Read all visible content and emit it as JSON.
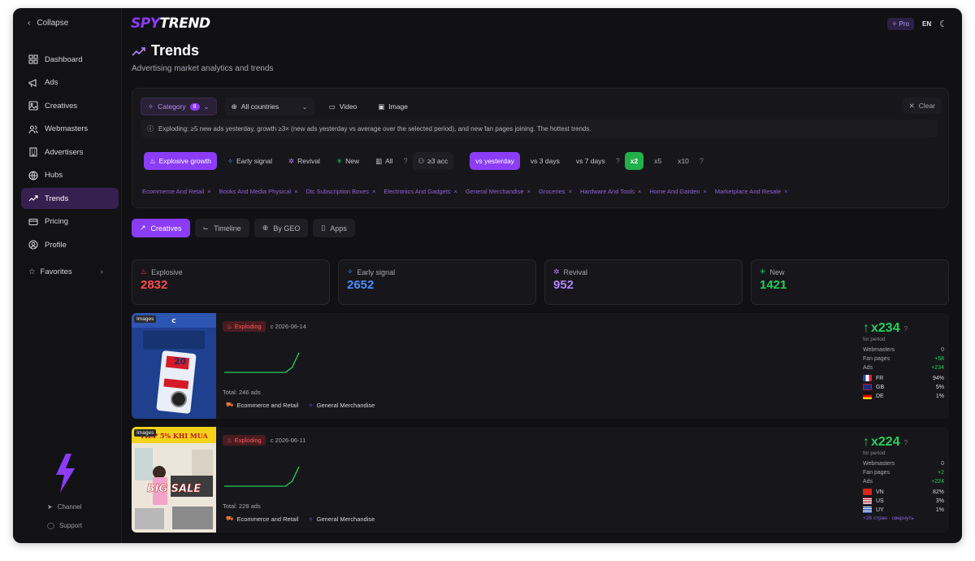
{
  "app": {
    "logo_part1": "SPY",
    "logo_part2": "TREND",
    "pro": "Pro",
    "lang": "EN"
  },
  "sidebar": {
    "collapse": "Collapse",
    "items": [
      {
        "label": "Dashboard",
        "icon": "dashboard-icon"
      },
      {
        "label": "Ads",
        "icon": "megaphone-icon"
      },
      {
        "label": "Creatives",
        "icon": "image-icon"
      },
      {
        "label": "Webmasters",
        "icon": "users-icon"
      },
      {
        "label": "Advertisers",
        "icon": "building-icon"
      },
      {
        "label": "Hubs",
        "icon": "globe-icon"
      },
      {
        "label": "Trends",
        "icon": "trend-icon",
        "active": true
      },
      {
        "label": "Pricing",
        "icon": "card-icon"
      },
      {
        "label": "Profile",
        "icon": "profile-icon"
      }
    ],
    "favorites": "Favorites",
    "channel": "Channel",
    "support": "Support"
  },
  "page": {
    "title": "Trends",
    "subtitle": "Advertising market analytics and trends"
  },
  "filters": {
    "category": "Category",
    "category_count": "8",
    "countries": "All countries",
    "video": "Video",
    "image": "Image",
    "clear": "Clear",
    "info": "Exploding: ≥5 new ads yesterday, growth ≥3× (new ads yesterday vs average over the selected period), and new fan pages joining. The hottest trends.",
    "signals": [
      "Explosive growth",
      "Early signal",
      "Revival",
      "New",
      "All"
    ],
    "acc": "≥3 acc",
    "periods": [
      "vs yesterday",
      "vs 3 days",
      "vs 7 days"
    ],
    "multipliers": [
      "x2",
      "x5",
      "x10"
    ],
    "tags": [
      "Ecommerce And Retail",
      "Books And Media Physical",
      "Dtc Subscription Boxes",
      "Electronics And Gadgets",
      "General Merchandise",
      "Groceries",
      "Hardware And Tools",
      "Home And Garden",
      "Marketplace And Resale"
    ]
  },
  "tabs": [
    "Creatives",
    "Timeline",
    "By GEO",
    "Apps"
  ],
  "stats": [
    {
      "label": "Explosive",
      "value": "2832",
      "color": "#ff4a4a"
    },
    {
      "label": "Early signal",
      "value": "2652",
      "color": "#4a8cff"
    },
    {
      "label": "Revival",
      "value": "952",
      "color": "#b084f7"
    },
    {
      "label": "New",
      "value": "1421",
      "color": "#21d05a"
    }
  ],
  "cards": [
    {
      "thumb_tag": "Images",
      "status": "Exploding",
      "since": "c 2026-06-14",
      "total": "Total: 246 ads",
      "cats": [
        "Ecommerce and Retail",
        "General Merchandise"
      ],
      "mult": "x234",
      "for_period": "for period",
      "webmasters_label": "Webmasters",
      "webmasters": "0",
      "fanpages_label": "Fan pages",
      "fanpages": "+58",
      "ads_label": "Ads",
      "ads": "+234",
      "geo": [
        {
          "code": "FR",
          "pct": "94%"
        },
        {
          "code": "GB",
          "pct": "5%"
        },
        {
          "code": "DE",
          "pct": "1%"
        }
      ],
      "more": "",
      "spark": [
        1,
        1,
        1,
        1,
        1,
        1,
        1,
        1,
        1,
        1,
        3,
        9
      ]
    },
    {
      "thumb_tag": "Images",
      "status": "Exploding",
      "since": "c 2026-06-11",
      "total": "Total: 228 ads",
      "cats": [
        "Ecommerce and Retail",
        "General Merchandise"
      ],
      "mult": "x224",
      "for_period": "for period",
      "webmasters_label": "Webmasters",
      "webmasters": "0",
      "fanpages_label": "Fan pages",
      "fanpages": "+2",
      "ads_label": "Ads",
      "ads": "+224",
      "geo": [
        {
          "code": "VN",
          "pct": "82%"
        },
        {
          "code": "US",
          "pct": "3%"
        },
        {
          "code": "UY",
          "pct": "1%"
        }
      ],
      "more": "+26 стран · свернуть",
      "spark": [
        1,
        1,
        1,
        1,
        1,
        1,
        1,
        1,
        1,
        1,
        3,
        9
      ]
    }
  ]
}
